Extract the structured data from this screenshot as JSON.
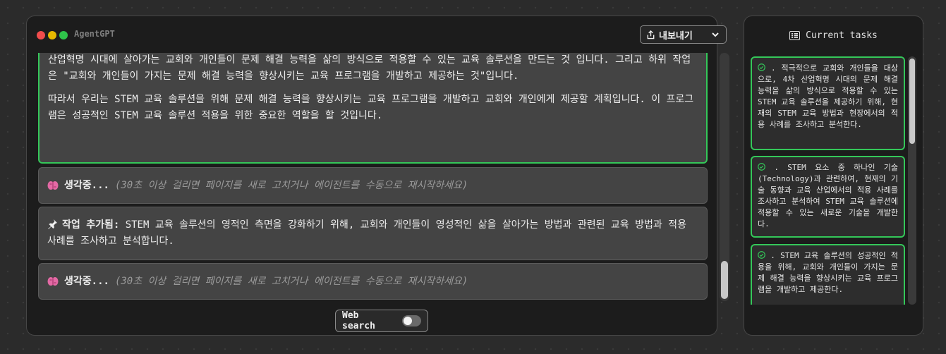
{
  "window": {
    "title": "AgentGPT",
    "traffic_light_colors": [
      "#f04c4c",
      "#e6b800",
      "#2fc24a"
    ],
    "export_label": "내보내기"
  },
  "messages": [
    {
      "paragraphs": [
        "산업혁명 시대에 살아가는 교회와 개인들이 문제 해결 능력을 삶의 방식으로 적용할 수 있는 교육 솔루션을 만드는 것 입니다. 그리고 하위 작업은 \"교회와 개인들이 가지는 문제 해결 능력을 향상시키는 교육 프로그램을 개발하고 제공하는 것\"입니다.",
        "따라서 우리는 STEM 교육 솔루션을 위해 문제 해결 능력을 향상시키는 교육 프로그램을 개발하고 교회와 개인에게 제공할 계획입니다. 이 프로그램은 성공적인 STEM 교육 솔루션 적용을 위한 중요한 역할을 할 것입니다."
      ]
    },
    {
      "label": "생각중...",
      "note": "(30초 이상 걸리면 페이지를 새로 고치거나 에이전트를 수동으로 재시작하세요)"
    },
    {
      "label": "작업 추가됨:",
      "text": "STEM 교육 솔루션의 영적인 측면을 강화하기 위해, 교회와 개인들이 영성적인 삶을 살아가는 방법과 관련된 교육 방법과 적용 사례를 조사하고 분석합니다."
    },
    {
      "label": "생각중...",
      "note": "(30초 이상 걸리면 페이지를 새로 고치거나 에이전트를 수동으로 재시작하세요)"
    }
  ],
  "web_search": {
    "label": "Web search",
    "enabled": false
  },
  "tasks_panel": {
    "title": "Current tasks",
    "tasks": [
      ". 적극적으로 교회와 개인들을 대상으로, 4차 산업혁명 시대의 문제 해결 능력을 삶의 방식으로 적용할 수 있는 STEM 교육 솔루션을 제공하기 위해, 현재의 STEM 교육 방법과 현장에서의 적용 사례를 조사하고 분석한다.",
      ". STEM 요소 중 하나인 기술(Technology)과 관련하여, 현재의 기술 동향과 교육 산업에서의 적용 사례를 조사하고 분석하여 STEM 교육 솔루션에 적용할 수 있는 새로운 기술을 개발한다.",
      ". STEM 교육 솔루션의 성공적인 적용을 위해, 교회와 개인들이 가지는 문제 해결 능력을 향상시키는 교육 프로그램을 개발하고 제공한다."
    ]
  },
  "colors": {
    "accent_green": "#34c759",
    "brain_pink": "#e46aa5"
  }
}
